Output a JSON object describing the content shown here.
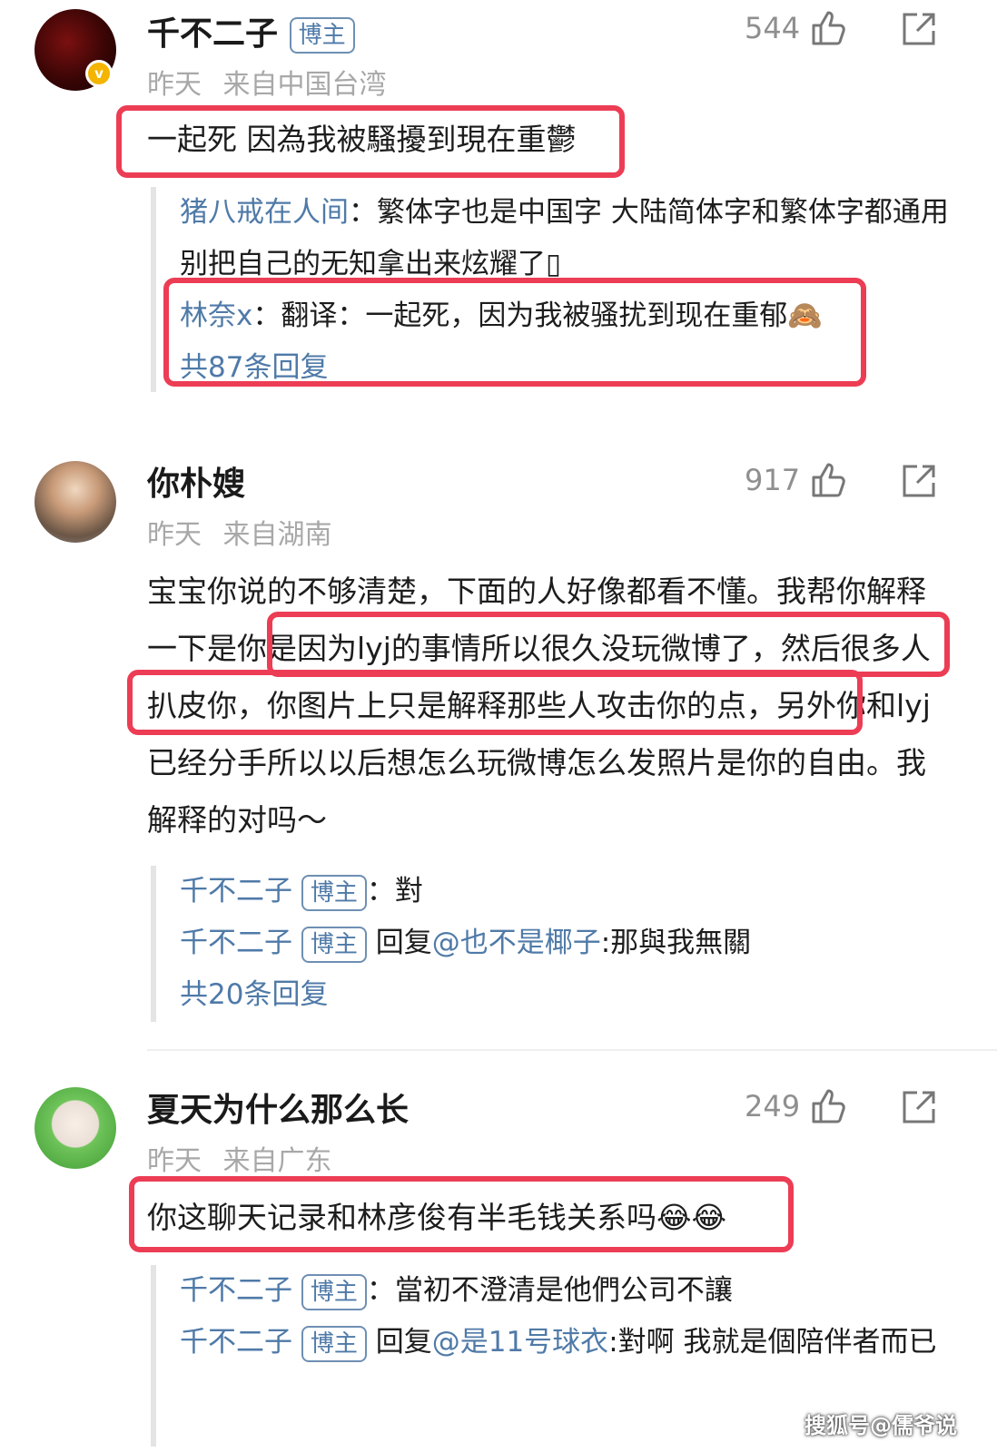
{
  "comments": [
    {
      "name": "千不二子",
      "tag": "博主",
      "time": "昨天",
      "location": "来自中国台湾",
      "likes": "544",
      "text": "一起死 因為我被騷擾到現在重鬱",
      "replies": [
        {
          "user": "猪八戒在人间",
          "sep": "：",
          "text": "繁体字也是中国字 大陆简体字和繁体字都通用 别把自己的无知拿出来炫耀了▯"
        },
        {
          "user": "林奈x",
          "sep": "：",
          "text": "翻译：一起死，因为我被骚扰到现在重郁"
        }
      ],
      "more": "共87条回复"
    },
    {
      "name": "你朴嫂",
      "time": "昨天",
      "location": "来自湖南",
      "likes": "917",
      "text": "宝宝你说的不够清楚，下面的人好像都看不懂。我帮你解释一下是你是因为lyj的事情所以很久没玩微博了，然后很多人扒皮你，你图片上只是解释那些人攻击你的点，另外你和lyj已经分手所以以后想怎么玩微博怎么发照片是你的自由。我解释的对吗～",
      "replies": [
        {
          "user": "千不二子",
          "tag": "博主",
          "sep": "：",
          "text": "對"
        },
        {
          "user": "千不二子",
          "tag": "博主",
          "reply_word": "回复",
          "mention": "@也不是椰子",
          "text": ":那與我無關"
        }
      ],
      "more": "共20条回复"
    },
    {
      "name": "夏天为什么那么长",
      "time": "昨天",
      "location": "来自广东",
      "likes": "249",
      "text": "你这聊天记录和林彦俊有半毛钱关系吗😂😂",
      "replies": [
        {
          "user": "千不二子",
          "tag": "博主",
          "sep": "：",
          "text": "當初不澄清是他們公司不讓"
        },
        {
          "user": "千不二子",
          "tag": "博主",
          "reply_word": "回复",
          "mention": "@是11号球衣",
          "text": ":對啊 我就是個陪伴者而已"
        }
      ]
    }
  ],
  "watermark": "搜狐号@儒爷说",
  "colors": {
    "highlight": "#ec3d55",
    "link": "#4f7aa8",
    "verified": "#f4b400"
  },
  "icons": [
    "thumbs-up-icon",
    "share-icon",
    "verified-icon"
  ]
}
